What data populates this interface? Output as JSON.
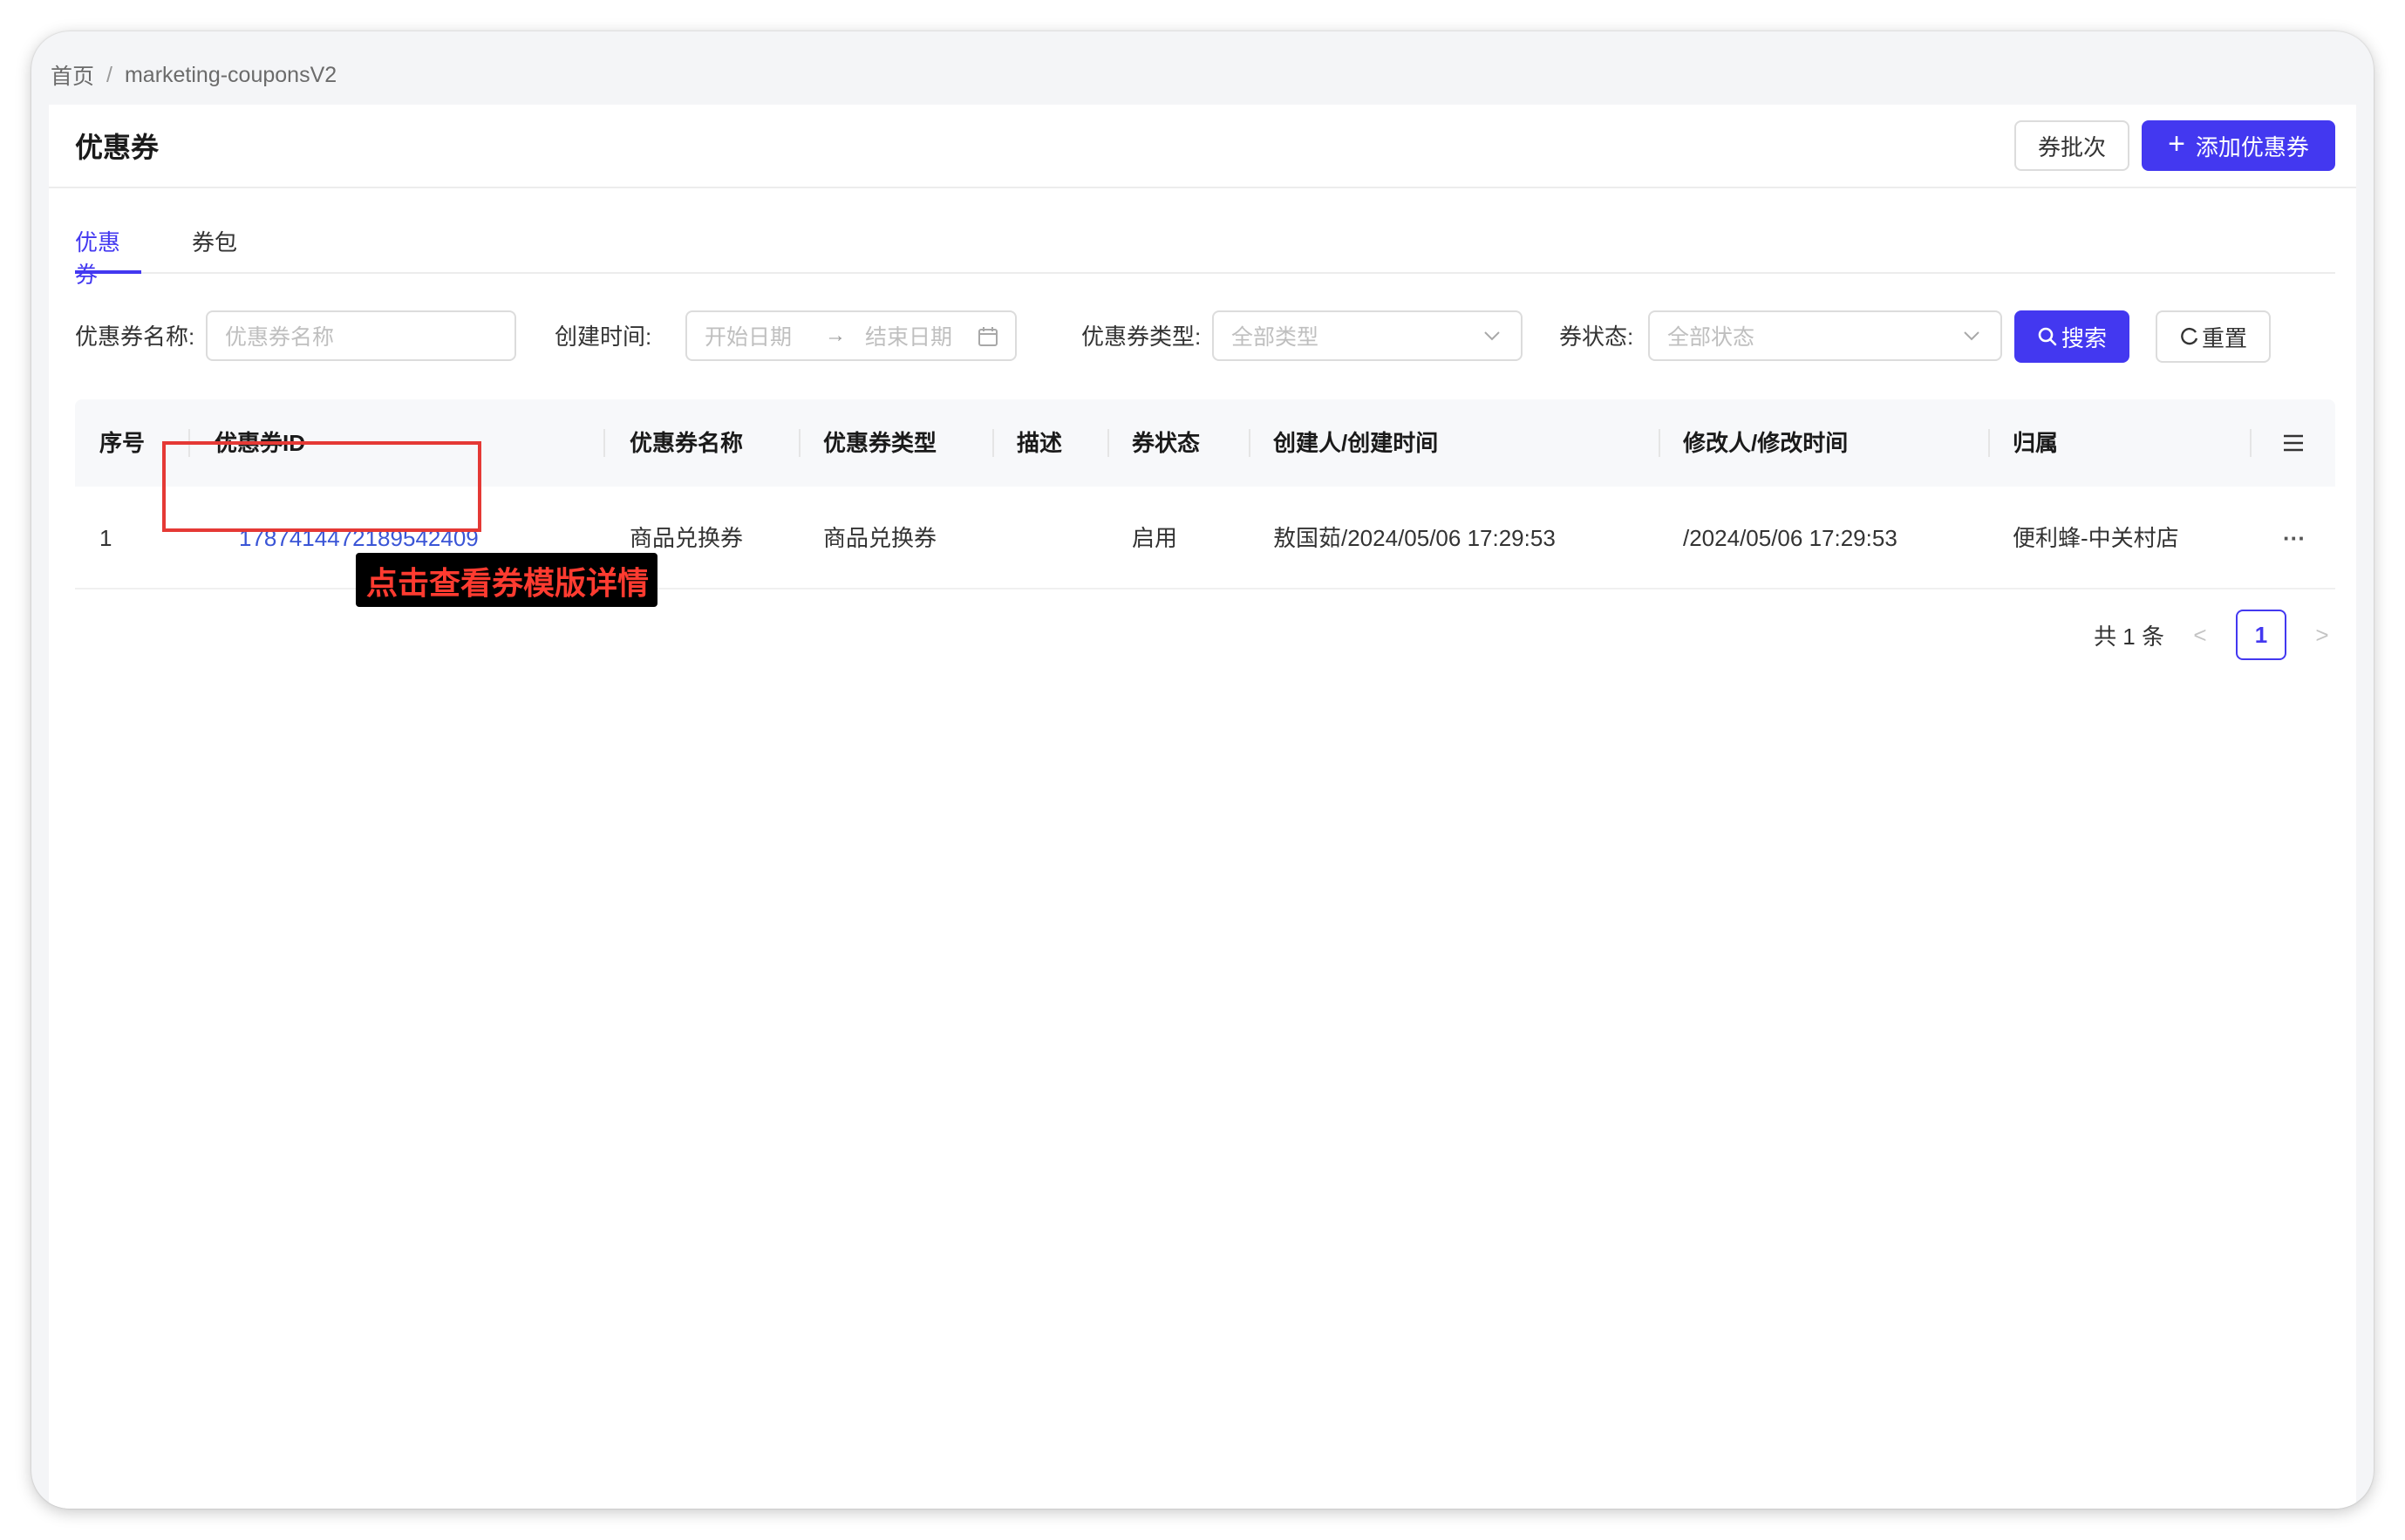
{
  "breadcrumb": {
    "home": "首页",
    "separator": "/",
    "current": "marketing-couponsV2"
  },
  "header": {
    "title": "优惠券",
    "batch_button": "券批次",
    "add_button": "添加优惠券"
  },
  "tabs": [
    {
      "label": "优惠券",
      "active": true
    },
    {
      "label": "券包",
      "active": false
    }
  ],
  "filters": {
    "name_label": "优惠券名称:",
    "name_placeholder": "优惠券名称",
    "time_label": "创建时间:",
    "start_placeholder": "开始日期",
    "end_placeholder": "结束日期",
    "type_label": "优惠券类型:",
    "type_placeholder": "全部类型",
    "status_label": "券状态:",
    "status_placeholder": "全部状态",
    "search_button": "搜索",
    "reset_button": "重置"
  },
  "table": {
    "columns": [
      "序号",
      "优惠券ID",
      "优惠券名称",
      "优惠券类型",
      "描述",
      "券状态",
      "创建人/创建时间",
      "修改人/修改时间",
      "归属"
    ],
    "rows": [
      {
        "index": "1",
        "id": "1787414472189542409",
        "name": "商品兑换券",
        "type": "商品兑换券",
        "desc": "",
        "status": "启用",
        "creator": "敖国茹/2024/05/06 17:29:53",
        "modifier": "/2024/05/06 17:29:53",
        "owner": "便利蜂-中关村店",
        "more": "···"
      }
    ]
  },
  "annotation": "点击查看券模版详情",
  "pagination": {
    "total": "共 1 条",
    "current": "1",
    "prev": "<",
    "next": ">"
  },
  "colors": {
    "primary": "#4338f0",
    "link": "#3a55d6",
    "highlight": "#e53935"
  }
}
